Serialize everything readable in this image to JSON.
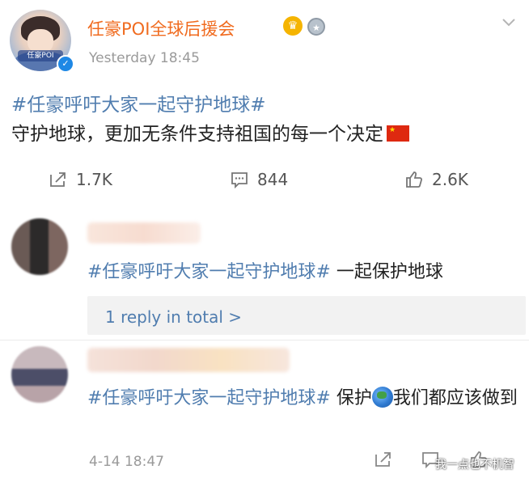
{
  "post": {
    "avatar_caption": "任豪POI",
    "username": "任豪POI全球后援会",
    "time": "Yesterday 18:45",
    "hashtag": "#任豪呼吁大家一起守护地球#",
    "text": "守护地球，更加无条件支持祖国的每一个决定",
    "actions": {
      "repost": "1.7K",
      "comments": "844",
      "likes": "2.6K"
    }
  },
  "comments": [
    {
      "hashtag": "#任豪呼吁大家一起守护地球#",
      "text": " 一起保护地球",
      "reply_link": "1 reply in total >"
    },
    {
      "hashtag": "#任豪呼吁大家一起守护地球#",
      "text_before": " 保护",
      "text_after": "我们都应该做到",
      "time": "4-14 18:47"
    }
  ],
  "watermark": "我一点也不机智",
  "colors": {
    "username": "#f06b1f",
    "link": "#507daf",
    "muted": "#9a9a9a"
  }
}
